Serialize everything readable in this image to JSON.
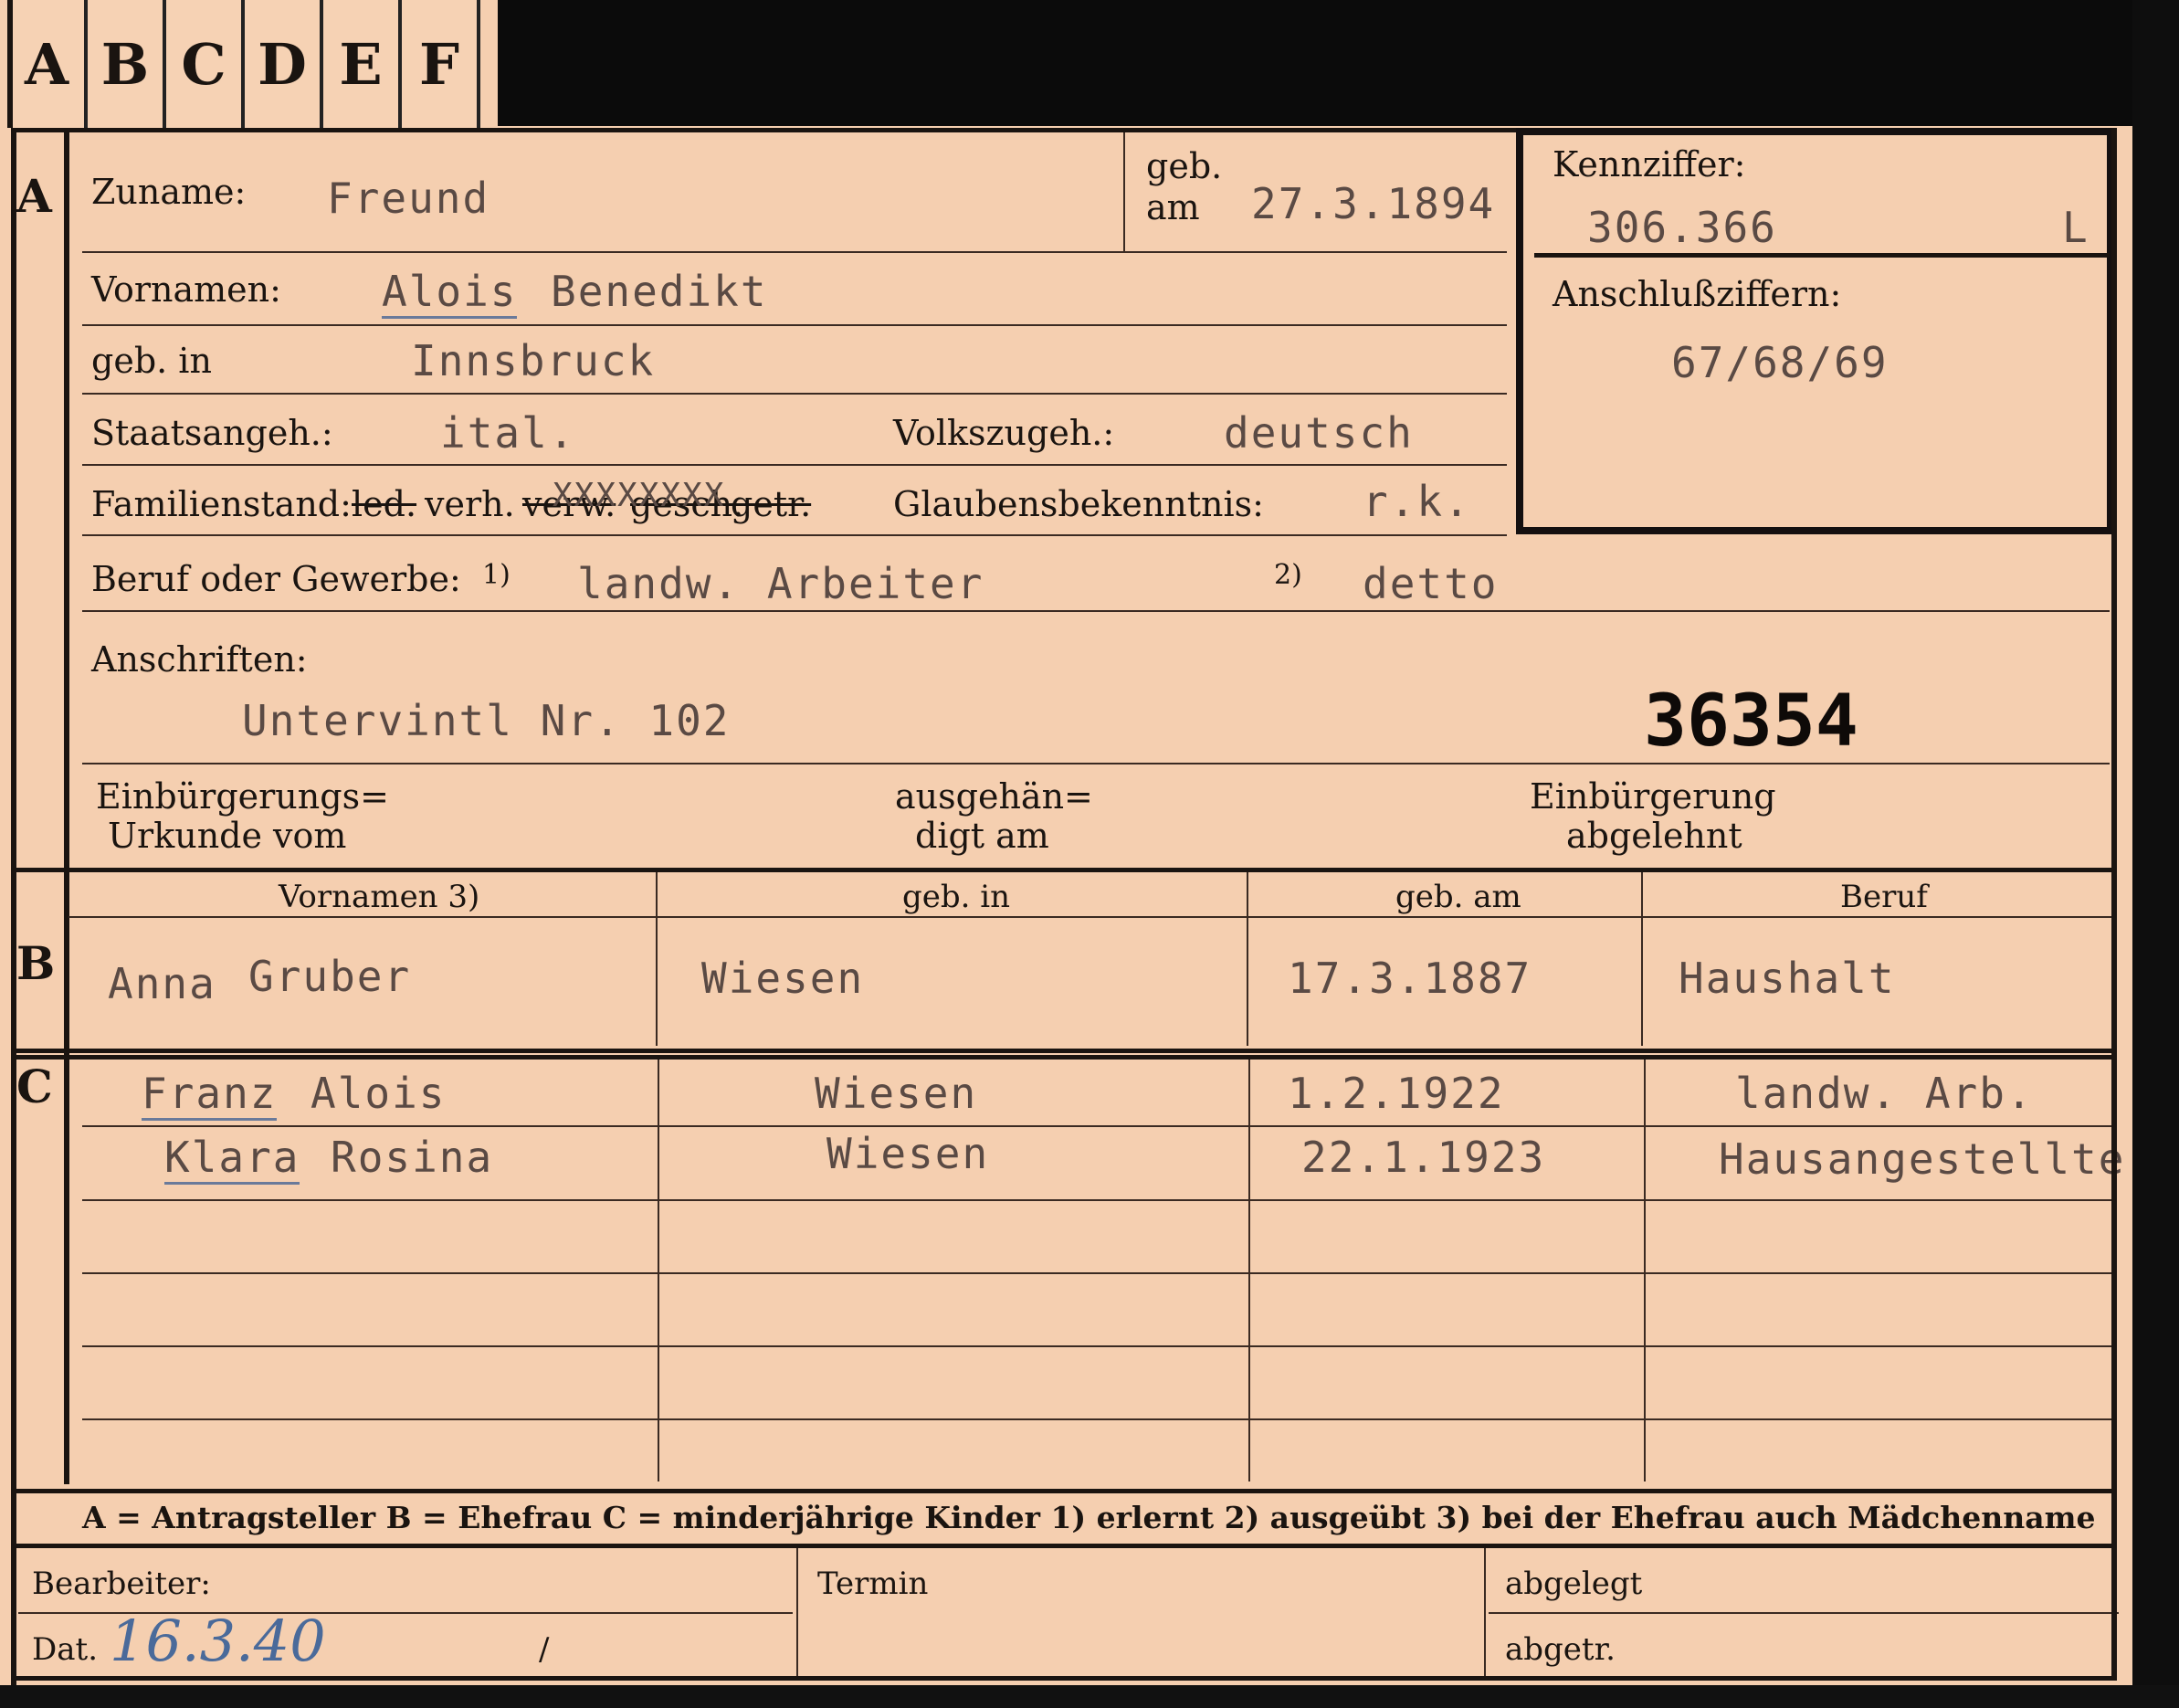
{
  "tabs": [
    "A",
    "B",
    "C",
    "D",
    "E",
    "F"
  ],
  "sections": {
    "a": "A",
    "b": "B",
    "c": "C"
  },
  "applicant": {
    "surname_label": "Zuname:",
    "surname": "Freund",
    "born_on_label_1": "geb.",
    "born_on_label_2": "am",
    "born_on": "27.3.1894",
    "given_names_label": "Vornamen:",
    "given_name_1": "Alois",
    "given_name_2": "Benedikt",
    "birthplace_label": "geb. in",
    "birthplace": "Innsbruck",
    "citizenship_label": "Staatsangeh.:",
    "citizenship": "ital.",
    "nationality_label": "Volkszugeh.:",
    "nationality": "deutsch",
    "marital_label": "Familienstand:",
    "marital_options": [
      "led.",
      "verh.",
      "verw.",
      "gesch.",
      "getr."
    ],
    "marital_strike": "XXXXXXXX",
    "religion_label": "Glaubensbekenntnis:",
    "religion": "r.k.",
    "occupation_label": "Beruf oder Gewerbe:",
    "occ_mark_1": "1)",
    "occupation_learned": "landw. Arbeiter",
    "occ_mark_2": "2)",
    "occupation_practiced": "detto",
    "address_label": "Anschriften:",
    "address": "Untervintl Nr. 102",
    "file_number": "36354",
    "naturalization_label_1": "Einbürgerungs=",
    "naturalization_label_2": "Urkunde vom",
    "handed_label_1": "ausgehän=",
    "handed_label_2": "digt am",
    "rejected_label_1": "Einbürgerung",
    "rejected_label_2": "abgelehnt"
  },
  "id_box": {
    "code_label": "Kennziffer:",
    "code": "306.366",
    "code_suffix": "L",
    "link_label": "Anschlußziffern:",
    "links": "67/68/69"
  },
  "spouse": {
    "headers": [
      "Vornamen 3)",
      "geb. in",
      "geb. am",
      "Beruf"
    ],
    "first_name": "Anna",
    "surname": "Gruber",
    "birthplace": "Wiesen",
    "born_on": "17.3.1887",
    "occupation": "Haushalt"
  },
  "children": [
    {
      "first": "Franz",
      "second": "Alois",
      "birthplace": "Wiesen",
      "born_on": "1.2.1922",
      "occupation": "landw. Arb."
    },
    {
      "first": "Klara",
      "second": "Rosina",
      "birthplace": "Wiesen",
      "born_on": "22.1.1923",
      "occupation": "Hausangestellte"
    }
  ],
  "legend": "A = Antragsteller   B = Ehefrau   C = minderjährige Kinder   1) erlernt   2) ausgeübt   3) bei der Ehefrau auch Mädchenname",
  "footer": {
    "clerk_label": "Bearbeiter:",
    "date_label": "Dat.",
    "date": "16.3.40",
    "slash": "/",
    "deadline_label": "Termin",
    "filed_label": "abgelegt",
    "separated_label": "abgetr."
  }
}
